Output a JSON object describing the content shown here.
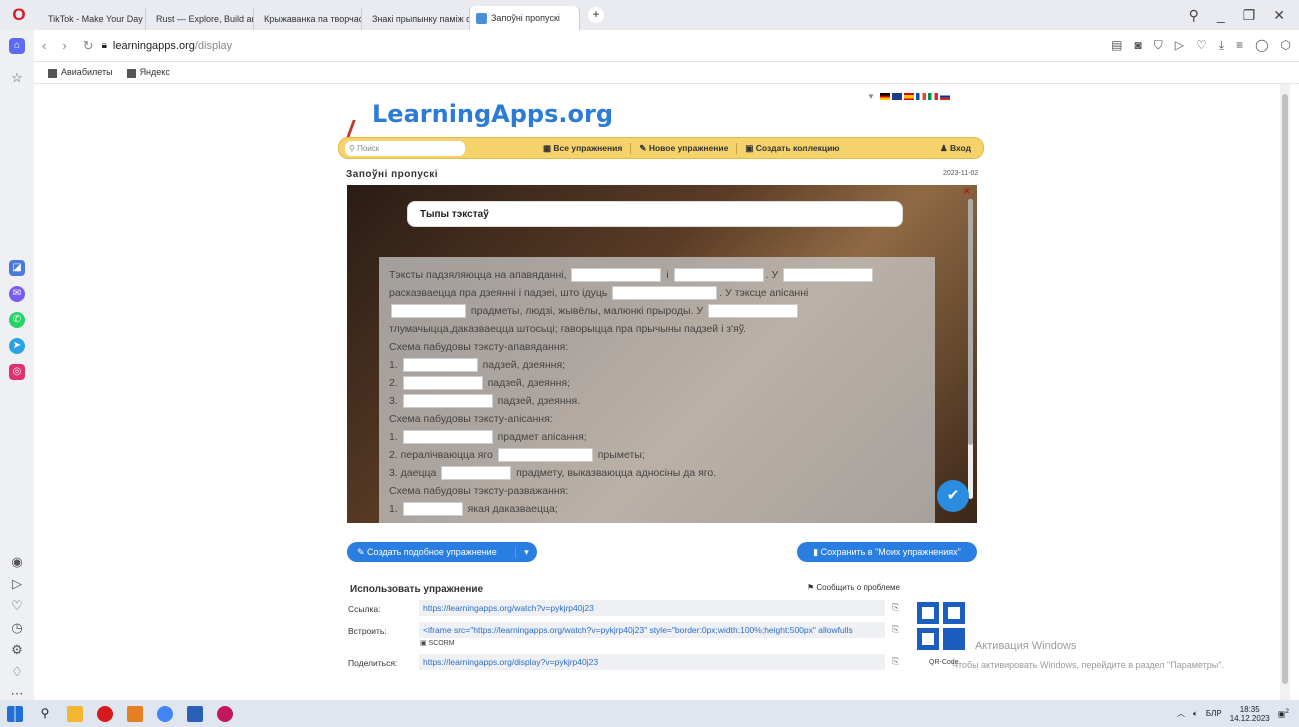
{
  "browser": {
    "tabs": [
      {
        "label": "TikTok - Make Your Day",
        "color": "#111111"
      },
      {
        "label": "Rust — Explore, Build and",
        "color": "#c0392b"
      },
      {
        "label": "Крыжаванка па творчас",
        "color": "#4a90d9"
      },
      {
        "label": "Знакі прыпынку паміж с",
        "color": "#4a90d9"
      },
      {
        "label": "Запоўні пропускі",
        "color": "#4a90d9",
        "active": true
      }
    ],
    "url_host": "learningapps.org",
    "url_path": "/display",
    "bookmarks": [
      "Авиабилеты",
      "Яндекс"
    ]
  },
  "site": {
    "logo": "LearningApps.org",
    "search_placeholder": "Поиск",
    "nav": [
      "Все упражнения",
      "Новое упражнение",
      "Создать коллекцию"
    ],
    "login": "Вход"
  },
  "exercise": {
    "title": "Запоўні пропускі",
    "date": "2023-11-02",
    "header": "Тыпы тэкстаў",
    "lines": [
      {
        "parts": [
          "Тэксты падзяляюцца на апавяданні, ",
          "_90",
          " і ",
          "_90",
          ". У ",
          "_90"
        ]
      },
      {
        "parts": [
          "расказваецца пра дзеянні і падзеі, што ідуць ",
          "_105",
          ". У тэксце апісанні"
        ]
      },
      {
        "parts": [
          "_75",
          " прадметы, людзі, жывёлы, малюнкі прыроды. У ",
          "_90"
        ]
      },
      {
        "parts": [
          "тлумачыцца,даказваецца штосьці; гаворыцца пра прычыны падзей і з'яў."
        ]
      },
      {
        "parts": [
          "Схема пабудовы тэксту-апавядання:"
        ]
      },
      {
        "parts": [
          "1. ",
          "_75",
          " падзей, дзеяння;"
        ]
      },
      {
        "parts": [
          "2. ",
          "_80",
          " падзей, дзеяння;"
        ]
      },
      {
        "parts": [
          "3. ",
          "_90",
          " падзей, дзеяння."
        ]
      },
      {
        "parts": [
          "Схема пабудовы тэксту-апісання:"
        ]
      },
      {
        "parts": [
          "1. ",
          "_90",
          " прадмет апісання;"
        ]
      },
      {
        "parts": [
          "2. пералічваюцца яго ",
          "_95",
          " прыметы;"
        ]
      },
      {
        "parts": [
          "3. даецца ",
          "_70",
          " прадмету, выказваюцца адносіны да яго."
        ]
      },
      {
        "parts": [
          "Схема пабудовы тэксту-разважання:"
        ]
      },
      {
        "parts": [
          "1. ",
          "_60",
          " якая даказваецца;"
        ]
      }
    ]
  },
  "actions": {
    "create_similar": "Создать подобное упражнение",
    "save": "Сохранить в \"Моих упражнениях\"",
    "use_title": "Использовать упражнение",
    "report": "Сообщить о проблеме",
    "rows": [
      {
        "label": "Ссылка:",
        "value": "https://learningapps.org/watch?v=pykjrp40j23"
      },
      {
        "label": "Встроить:",
        "value": "<iframe src=\"https://learningapps.org/watch?v=pykjrp40j23\" style=\"border:0px;width:100%;height:500px\" allowfulls"
      },
      {
        "label": "Поделиться:",
        "value": "https://learningapps.org/display?v=pykjrp40j23"
      }
    ],
    "scorm": "SCORM",
    "qr_label": "QR-Code"
  },
  "watermark": {
    "line1": "Активация Windows",
    "line2": "Чтобы активировать Windows, перейдите в раздел \"Параметры\"."
  },
  "taskbar": {
    "lang": "БЛР",
    "time": "18:35",
    "date": "14.12.2023",
    "notifications": "2"
  }
}
